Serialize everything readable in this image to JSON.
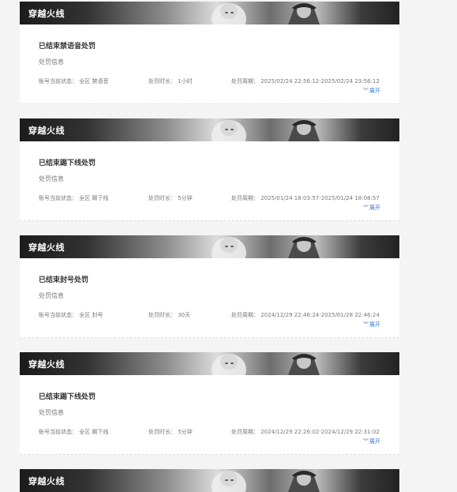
{
  "cards": [
    {
      "game": "穿越火线",
      "status_title": "已结束禁语音处罚",
      "info_label": "处罚信息",
      "state_text": "账号当前状态：  全区  禁语音",
      "duration_text": "处罚时长：  1小时",
      "period_text": "处罚周期：  2025/02/24 22:56:12-2025/02/24 23:56:12",
      "expand_label": "展开"
    },
    {
      "game": "穿越火线",
      "status_title": "已结束踢下线处罚",
      "info_label": "处罚信息",
      "state_text": "账号当前状态：  全区  踢下线",
      "duration_text": "处罚时长：  5分钟",
      "period_text": "处罚周期：  2025/01/24 18:03:57-2025/01/24 18:08:57",
      "expand_label": "展开"
    },
    {
      "game": "穿越火线",
      "status_title": "已结束封号处罚",
      "info_label": "处罚信息",
      "state_text": "账号当前状态：  全区  封号",
      "duration_text": "处罚时长：  30天",
      "period_text": "处罚周期：  2024/12/29 22:46:24-2025/01/28 22:46:24",
      "expand_label": "展开"
    },
    {
      "game": "穿越火线",
      "status_title": "已结束踢下线处罚",
      "info_label": "处罚信息",
      "state_text": "账号当前状态：  全区  踢下线",
      "duration_text": "处罚时长：  5分钟",
      "period_text": "处罚周期：  2024/12/29 22:26:02-2024/12/29 22:31:02",
      "expand_label": "展开"
    },
    {
      "game": "穿越火线"
    }
  ],
  "icons": {
    "expand": "double-chevron-down-icon"
  },
  "colors": {
    "link": "#3a7bd5",
    "banner_dark": "#1b1b1b"
  }
}
